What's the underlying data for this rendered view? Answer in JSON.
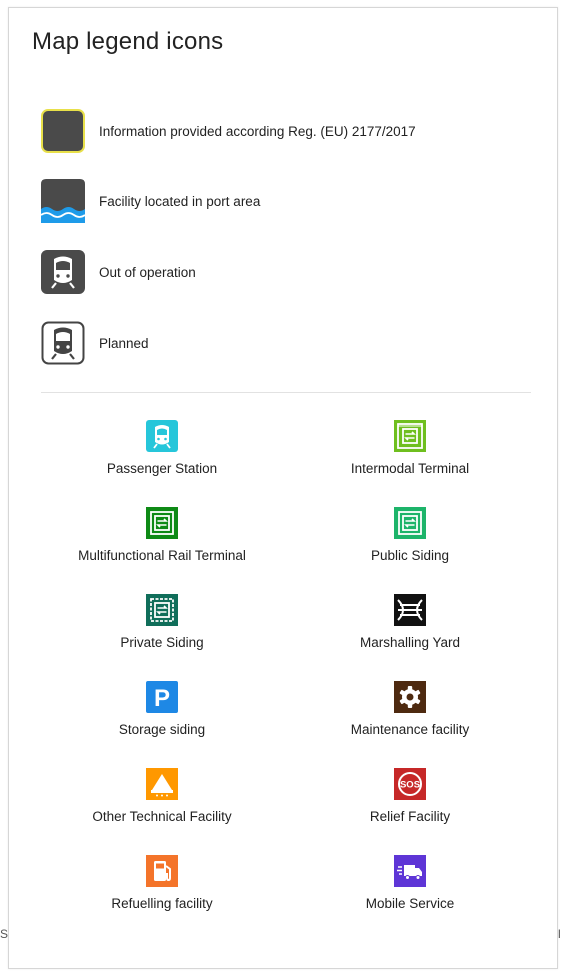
{
  "panel": {
    "title": "Map legend icons"
  },
  "legend_status": [
    {
      "icon": "yellow-border-square-icon",
      "label": "Information provided according Reg. (EU) 2177/2017"
    },
    {
      "icon": "port-area-water-icon",
      "label": "Facility located in port area"
    },
    {
      "icon": "out-of-operation-train-icon",
      "label": "Out of operation"
    },
    {
      "icon": "planned-train-icon",
      "label": "Planned"
    }
  ],
  "facilities": [
    {
      "icon": "passenger-station-icon",
      "label": "Passenger Station",
      "color": "#26C6DA"
    },
    {
      "icon": "intermodal-terminal-icon",
      "label": "Intermodal Terminal",
      "color": "#6FBF1F"
    },
    {
      "icon": "multifunctional-rail-terminal-icon",
      "label": "Multifunctional Rail Terminal",
      "color": "#0E8A16"
    },
    {
      "icon": "public-siding-icon",
      "label": "Public Siding",
      "color": "#1DB46A"
    },
    {
      "icon": "private-siding-icon",
      "label": "Private Siding",
      "color": "#106E5A"
    },
    {
      "icon": "marshalling-yard-icon",
      "label": "Marshalling Yard",
      "color": "#111111"
    },
    {
      "icon": "storage-siding-icon",
      "label": "Storage siding",
      "color": "#1E88E5"
    },
    {
      "icon": "maintenance-facility-icon",
      "label": "Maintenance facility",
      "color": "#4E2A10"
    },
    {
      "icon": "other-technical-facility-icon",
      "label": "Other Technical Facility",
      "color": "#FF9800"
    },
    {
      "icon": "relief-facility-icon",
      "label": "Relief Facility",
      "color": "#C62828"
    },
    {
      "icon": "refuelling-facility-icon",
      "label": "Refuelling facility",
      "color": "#F4742A"
    },
    {
      "icon": "mobile-service-icon",
      "label": "Mobile Service",
      "color": "#5E35D6"
    }
  ],
  "icon_text": {
    "storage": "P",
    "relief": "SOS"
  },
  "background": {
    "left_fragment": "S",
    "right_fragment": "l"
  }
}
